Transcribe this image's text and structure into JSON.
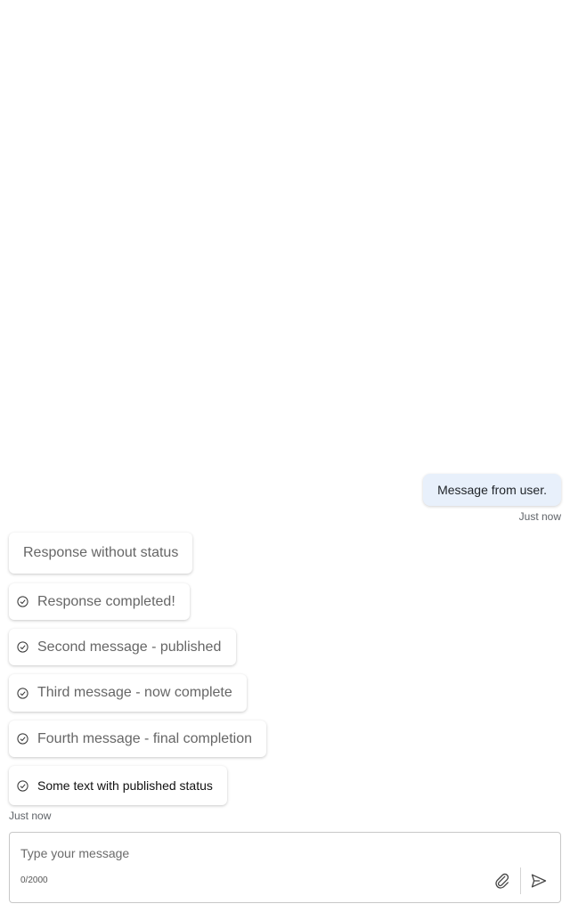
{
  "messages": {
    "user": {
      "text": "Message from user.",
      "time": "Just now"
    },
    "bot": [
      {
        "text": "Response without status",
        "status_icon": ""
      },
      {
        "text": "Response completed!",
        "status_icon": "check-circle-icon"
      },
      {
        "text": "Second message - published",
        "status_icon": "check-circle-icon"
      },
      {
        "text": "Third message - now complete",
        "status_icon": "check-circle-icon"
      },
      {
        "text": "Fourth message - final completion",
        "status_icon": "check-circle-icon"
      },
      {
        "text": "Some text with published status",
        "status_icon": "check-circle-icon"
      }
    ],
    "bot_time": "Just now"
  },
  "composer": {
    "placeholder": "Type your message",
    "value": "",
    "char_count": "0/2000",
    "attach_icon": "paperclip-icon",
    "send_icon": "send-icon"
  },
  "colors": {
    "user_bubble": "#e8f0fb",
    "bot_text": "#666666",
    "border": "#c8c8c8"
  }
}
